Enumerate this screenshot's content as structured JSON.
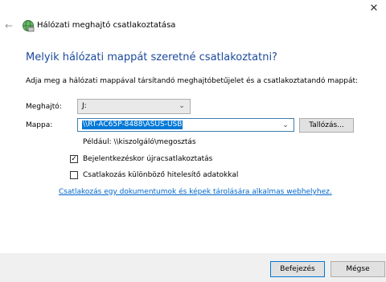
{
  "window": {
    "title": "Hálózati meghajtó csatlakoztatása",
    "back_icon": "back-arrow-icon",
    "app_icon": "network-drive-icon",
    "close_glyph": "✕"
  },
  "main": {
    "heading": "Melyik hálózati mappát szeretné csatlakoztatni?",
    "description": "Adja meg a hálózati mappával társítandó meghajtóbetűjelet és a csatlakoztatandó mappát:",
    "drive": {
      "label": "Meghajtó:",
      "value": "J:"
    },
    "folder": {
      "label": "Mappa:",
      "value": "\\\\RT-AC65P-8488\\ASUS-USB"
    },
    "browse_label": "Tallózás...",
    "example": "Például: \\\\kiszolgáló\\megosztás",
    "reconnect": {
      "label": "Bejelentkezéskor újracsatlakoztatás",
      "checked": true
    },
    "other_credentials": {
      "label": "Csatlakozás különböző hitelesítő adatokkal",
      "checked": false
    },
    "link": "Csatlakozás egy dokumentumok és képek tárolására alkalmas webhelyhez."
  },
  "footer": {
    "finish_label": "Befejezés",
    "cancel_label": "Mégse"
  },
  "colors": {
    "heading": "#1b4a9c",
    "selection": "#0078d7",
    "link": "#0066cc",
    "footer_bg": "#f0f0f0"
  }
}
